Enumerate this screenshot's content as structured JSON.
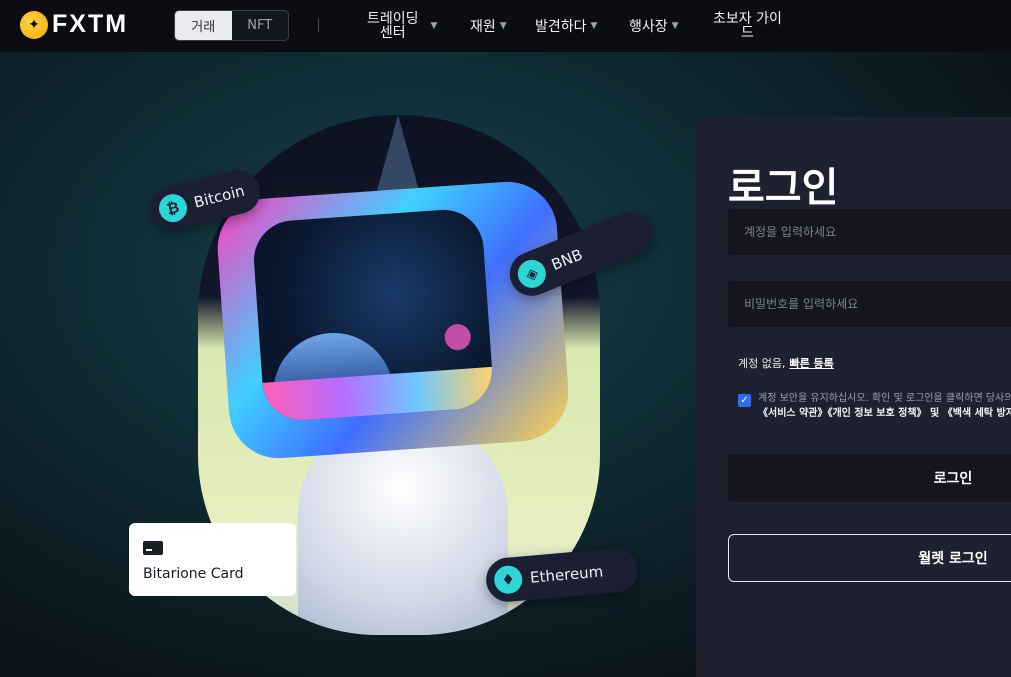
{
  "header": {
    "logo_text": "FXTM",
    "segment": {
      "options": [
        "거래",
        "NFT"
      ],
      "active": "거래"
    },
    "nav": [
      {
        "label": "트레이딩 센터",
        "line1": "트레이딩",
        "line2": "센터",
        "has_caret": true
      },
      {
        "label": "재원",
        "has_caret": true
      },
      {
        "label": "발견하다",
        "has_caret": true
      },
      {
        "label": "행사장",
        "has_caret": true
      },
      {
        "label": "초보자 가이드",
        "line1": "초보자 가이",
        "line2": "드",
        "has_caret": false
      }
    ]
  },
  "hero": {
    "pills": {
      "bitcoin": {
        "label": "Bitcoin",
        "icon": "bitcoin-icon",
        "glyph": "₿"
      },
      "bnb": {
        "label": "BNB",
        "icon": "bnb-icon",
        "glyph": "◈"
      },
      "ethereum": {
        "label": "Ethereum",
        "icon": "ethereum-icon",
        "glyph": "♦"
      }
    },
    "card": {
      "label": "Bitarione Card",
      "icon": "card-icon"
    }
  },
  "login": {
    "title": "로그인",
    "account_placeholder": "계정을 입력하세요",
    "password_placeholder": "비밀번호를 입력하세요",
    "no_account_text": "계정 없음,",
    "signup_link": "빠른 등록",
    "consent_checked": true,
    "consent_line1": "계정 보안을 유지하십시오. 확인 및 로그인을 클릭하면 당사의",
    "consent_links": "《서비스 약관》《개인 정보 보호 정책》 및 《백색 세탁 방지",
    "login_button": "로그인",
    "wallet_button": "월렛 로그인"
  },
  "colors": {
    "accent_blue": "#2f6cf0",
    "panel_bg": "#1f2130",
    "topbar_bg": "#0b0d13",
    "coin_teal": "#2fd5d5"
  }
}
